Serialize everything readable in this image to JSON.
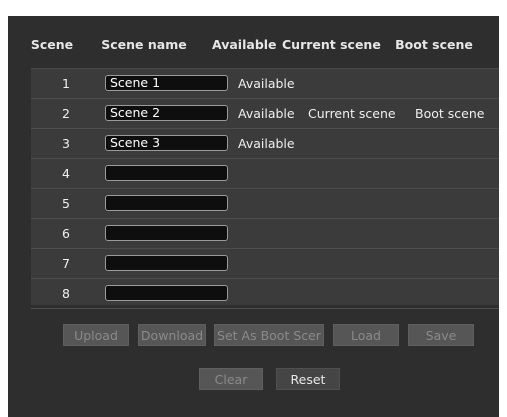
{
  "table": {
    "headers": {
      "scene": "Scene",
      "scene_name": "Scene name",
      "available": "Available",
      "current_scene": "Current scene",
      "boot_scene": "Boot scene"
    },
    "rows": [
      {
        "num": "1",
        "name": "Scene 1",
        "available": "Available",
        "current": "",
        "boot": ""
      },
      {
        "num": "2",
        "name": "Scene 2",
        "available": "Available",
        "current": "Current scene",
        "boot": "Boot scene"
      },
      {
        "num": "3",
        "name": "Scene 3",
        "available": "Available",
        "current": "",
        "boot": ""
      },
      {
        "num": "4",
        "name": "",
        "available": "",
        "current": "",
        "boot": ""
      },
      {
        "num": "5",
        "name": "",
        "available": "",
        "current": "",
        "boot": ""
      },
      {
        "num": "6",
        "name": "",
        "available": "",
        "current": "",
        "boot": ""
      },
      {
        "num": "7",
        "name": "",
        "available": "",
        "current": "",
        "boot": ""
      },
      {
        "num": "8",
        "name": "",
        "available": "",
        "current": "",
        "boot": ""
      }
    ]
  },
  "buttons": {
    "upload": "Upload",
    "download": "Download",
    "set_as_boot": "Set As Boot Scer",
    "load": "Load",
    "save": "Save",
    "clear": "Clear",
    "reset": "Reset"
  }
}
